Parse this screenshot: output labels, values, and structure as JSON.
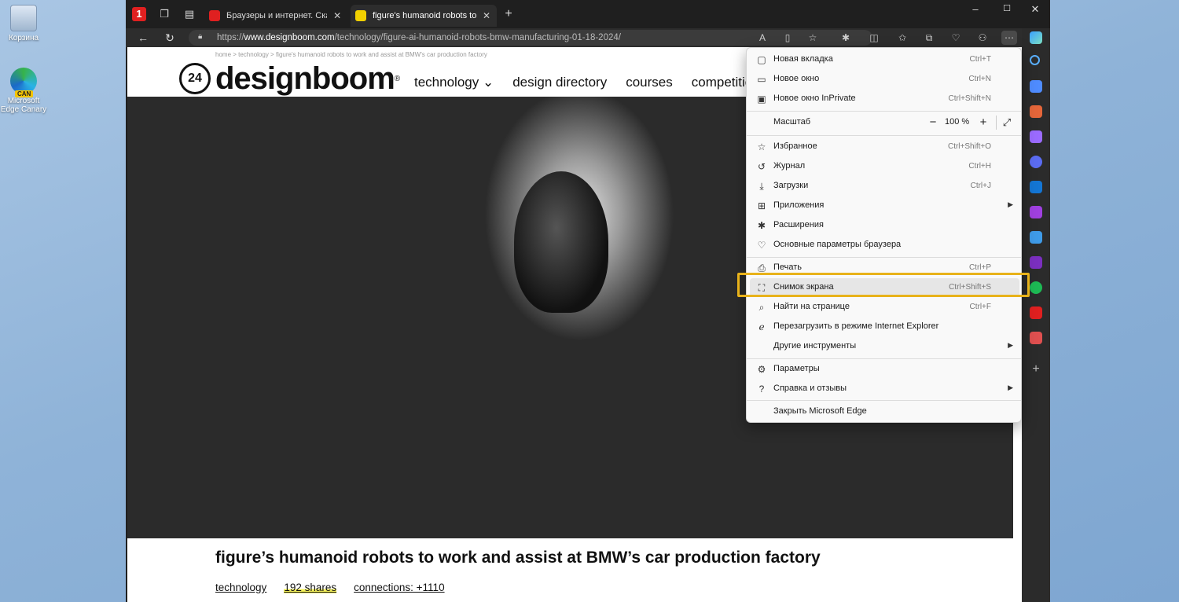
{
  "desktop": {
    "recycle_bin": "Корзина",
    "edge_canary": "Microsoft Edge Canary",
    "edge_canary_badge": "CAN"
  },
  "tabs": [
    {
      "title": "Браузеры и интернет. Скачать б",
      "active": false,
      "favicon_color": "#e02020"
    },
    {
      "title": "figure's humanoid robots to work",
      "active": true,
      "favicon_color": "#f2d100"
    }
  ],
  "address": {
    "prefix": "https://",
    "host": "www.designboom.com",
    "path": "/technology/figure-ai-humanoid-robots-bmw-manufacturing-01-18-2024/"
  },
  "page": {
    "breadcrumb": "home > technology > figure's humanoid robots to work and assist at BMW's car production factory",
    "logo_badge": "24",
    "logo_text": "designboom",
    "logo_reg": "®",
    "nav": [
      "technology ⌄",
      "design directory",
      "courses",
      "competitio"
    ],
    "article_title": "figure’s humanoid robots to work and assist at BMW’s car production factory",
    "meta": {
      "category": "technology",
      "shares": "192 shares",
      "connections": "connections: +1110"
    }
  },
  "menu": {
    "items": [
      {
        "id": "new-tab",
        "label": "Новая вкладка",
        "shortcut": "Ctrl+T",
        "icon": "▢"
      },
      {
        "id": "new-window",
        "label": "Новое окно",
        "shortcut": "Ctrl+N",
        "icon": "▭"
      },
      {
        "id": "new-inprivate",
        "label": "Новое окно InPrivate",
        "shortcut": "Ctrl+Shift+N",
        "icon": "▣"
      },
      {
        "id": "zoom",
        "label": "Масштаб",
        "value": "100 %"
      },
      {
        "id": "favorites",
        "label": "Избранное",
        "shortcut": "Ctrl+Shift+O",
        "icon": "☆"
      },
      {
        "id": "history",
        "label": "Журнал",
        "shortcut": "Ctrl+H",
        "icon": "↺"
      },
      {
        "id": "downloads",
        "label": "Загрузки",
        "shortcut": "Ctrl+J",
        "icon": "⤓"
      },
      {
        "id": "apps",
        "label": "Приложения",
        "icon": "⊞",
        "submenu": true
      },
      {
        "id": "extensions",
        "label": "Расширения",
        "icon": "✱"
      },
      {
        "id": "essentials",
        "label": "Основные параметры браузера",
        "icon": "♡"
      },
      {
        "id": "print",
        "label": "Печать",
        "shortcut": "Ctrl+P",
        "icon": "⎙"
      },
      {
        "id": "screenshot",
        "label": "Снимок экрана",
        "shortcut": "Ctrl+Shift+S",
        "icon": "⛶"
      },
      {
        "id": "find",
        "label": "Найти на странице",
        "shortcut": "Ctrl+F",
        "icon": "⌕"
      },
      {
        "id": "ie-mode",
        "label": "Перезагрузить в режиме Internet Explorer",
        "icon": "ℯ"
      },
      {
        "id": "more-tools",
        "label": "Другие инструменты",
        "submenu": true
      },
      {
        "id": "settings",
        "label": "Параметры",
        "icon": "⚙"
      },
      {
        "id": "help",
        "label": "Справка и отзывы",
        "icon": "?",
        "submenu": true
      },
      {
        "id": "close",
        "label": "Закрыть Microsoft Edge"
      }
    ],
    "highlighted": "screenshot",
    "highlight_color": "#e8b21a"
  },
  "colors": {
    "accent": "#e8b21a",
    "menu_bg": "#f9f9f9",
    "chrome_bg": "#1f1f1f"
  }
}
